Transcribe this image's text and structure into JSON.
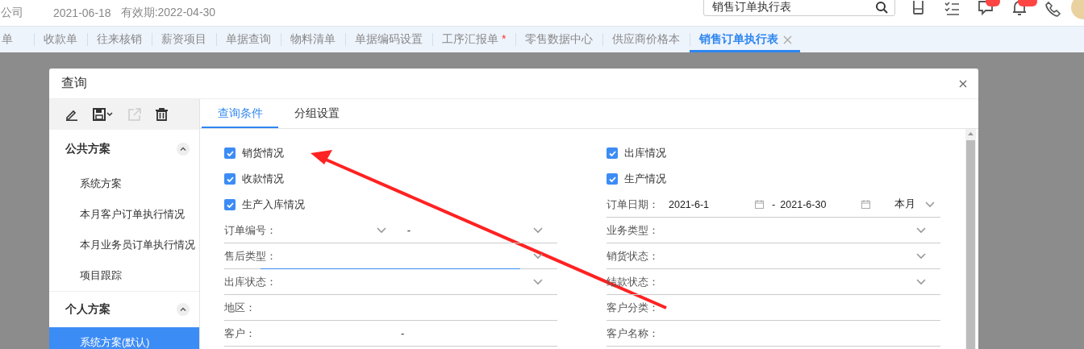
{
  "header": {
    "company": "公司",
    "date": "2021-06-18",
    "validity": "有效期:2022-04-30",
    "search": {
      "value": "销售订单执行表"
    }
  },
  "tabs": [
    {
      "label": "单",
      "selected": false
    },
    {
      "label": "收款单",
      "selected": false
    },
    {
      "label": "往来核销",
      "selected": false
    },
    {
      "label": "薪资项目",
      "selected": false
    },
    {
      "label": "单据查询",
      "selected": false
    },
    {
      "label": "物料清单",
      "selected": false
    },
    {
      "label": "单据编码设置",
      "selected": false
    },
    {
      "label": "工序汇报单",
      "mark": "*",
      "selected": false
    },
    {
      "label": "零售数据中心",
      "selected": false
    },
    {
      "label": "供应商价格本",
      "selected": false
    },
    {
      "label": "销售订单执行表",
      "selected": true
    }
  ],
  "dialog": {
    "title": "查询",
    "toolbar": [
      {
        "kind": "edit",
        "disabled": false
      },
      {
        "kind": "save",
        "disabled": false
      },
      {
        "kind": "export",
        "disabled": true
      },
      {
        "kind": "delete",
        "disabled": false
      }
    ],
    "groups": [
      {
        "title": "公共方案",
        "expanded": true,
        "items": [
          {
            "label": "系统方案",
            "selected": false
          },
          {
            "label": "本月客户订单执行情况",
            "selected": false
          },
          {
            "label": "本月业务员订单执行情况",
            "selected": false
          },
          {
            "label": "项目跟踪",
            "selected": false
          }
        ]
      },
      {
        "title": "个人方案",
        "expanded": true,
        "items": [
          {
            "label": "系统方案(默认)",
            "selected": true
          }
        ]
      }
    ],
    "form_tabs": [
      {
        "label": "查询条件",
        "selected": true
      },
      {
        "label": "分组设置",
        "selected": false
      }
    ],
    "fields": [
      {
        "kind": "checkbox",
        "label": "销货情况",
        "checked": true
      },
      {
        "kind": "checkbox",
        "label": "出库情况",
        "checked": true
      },
      {
        "kind": "checkbox",
        "label": "收款情况",
        "checked": true
      },
      {
        "kind": "checkbox",
        "label": "生产情况",
        "checked": true
      },
      {
        "kind": "checkbox",
        "label": "生产入库情况",
        "checked": true
      },
      {
        "kind": "date-range",
        "label": "订单日期：",
        "from": "2021-6-1",
        "separator": "-",
        "to": "2021-6-30",
        "preset": "本月"
      },
      {
        "kind": "select-range",
        "label": "订单编号：",
        "separator": "-"
      },
      {
        "kind": "select",
        "label": "业务类型：",
        "focused": false
      },
      {
        "kind": "select",
        "label": "售后类型：",
        "focused": true
      },
      {
        "kind": "select",
        "label": "销货状态：",
        "focused": false
      },
      {
        "kind": "select",
        "label": "出库状态：",
        "focused": false
      },
      {
        "kind": "select",
        "label": "结款状态：",
        "focused": false
      },
      {
        "kind": "text",
        "label": "地区："
      },
      {
        "kind": "text",
        "label": "客户分类："
      },
      {
        "kind": "text-range",
        "label": "客户：",
        "separator": "-"
      },
      {
        "kind": "text",
        "label": "客户名称："
      }
    ]
  }
}
